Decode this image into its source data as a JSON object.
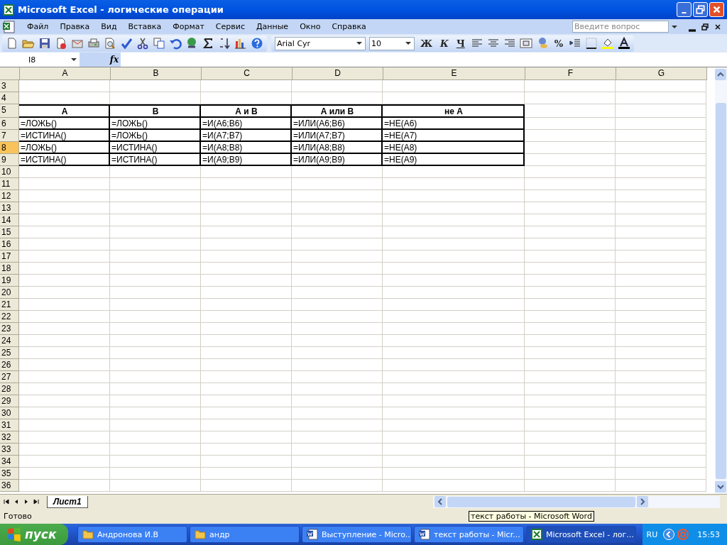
{
  "window": {
    "title": "Microsoft Excel - логические операции"
  },
  "menu": [
    "Файл",
    "Правка",
    "Вид",
    "Вставка",
    "Формат",
    "Сервис",
    "Данные",
    "Окно",
    "Справка"
  ],
  "help_search": {
    "placeholder": "Введите вопрос"
  },
  "format_toolbar": {
    "font": "Arial Cyr",
    "size": "10",
    "bold": "Ж",
    "italic": "К",
    "underline": "Ч",
    "percent": "%"
  },
  "formula_bar": {
    "name_box": "I8",
    "fx": "fx"
  },
  "columns": [
    {
      "label": "A",
      "selected": false
    },
    {
      "label": "B",
      "selected": false
    },
    {
      "label": "C",
      "selected": false
    },
    {
      "label": "D",
      "selected": false
    },
    {
      "label": "E",
      "selected": false
    },
    {
      "label": "F",
      "selected": false
    },
    {
      "label": "G",
      "selected": false
    }
  ],
  "rows": [
    {
      "number": "3",
      "selected": false,
      "kind": "empty"
    },
    {
      "number": "4",
      "selected": false,
      "kind": "empty"
    },
    {
      "number": "5",
      "selected": false,
      "kind": "header",
      "cells": [
        "A",
        "B",
        "А и В",
        "А или В",
        "не А"
      ]
    },
    {
      "number": "6",
      "selected": false,
      "kind": "data",
      "cells": [
        "=ЛОЖЬ()",
        "=ЛОЖЬ()",
        "=И(A6;B6)",
        "=ИЛИ(A6;B6)",
        "=НЕ(A6)"
      ]
    },
    {
      "number": "7",
      "selected": false,
      "kind": "data",
      "cells": [
        "=ИСТИНА()",
        "=ЛОЖЬ()",
        "=И(A7;B7)",
        "=ИЛИ(A7;B7)",
        "=НЕ(A7)"
      ]
    },
    {
      "number": "8",
      "selected": true,
      "kind": "data",
      "cells": [
        "=ЛОЖЬ()",
        "=ИСТИНА()",
        "=И(A8;B8)",
        "=ИЛИ(A8;B8)",
        "=НЕ(A8)"
      ]
    },
    {
      "number": "9",
      "selected": false,
      "kind": "data",
      "cells": [
        "=ИСТИНА()",
        "=ИСТИНА()",
        "=И(A9;B9)",
        "=ИЛИ(A9;B9)",
        "=НЕ(A9)"
      ]
    },
    {
      "number": "10",
      "selected": false,
      "kind": "empty"
    },
    {
      "number": "11",
      "selected": false,
      "kind": "empty"
    },
    {
      "number": "12",
      "selected": false,
      "kind": "empty"
    },
    {
      "number": "13",
      "selected": false,
      "kind": "empty"
    },
    {
      "number": "14",
      "selected": false,
      "kind": "empty"
    },
    {
      "number": "15",
      "selected": false,
      "kind": "empty"
    },
    {
      "number": "16",
      "selected": false,
      "kind": "empty"
    },
    {
      "number": "17",
      "selected": false,
      "kind": "empty"
    },
    {
      "number": "18",
      "selected": false,
      "kind": "empty"
    },
    {
      "number": "19",
      "selected": false,
      "kind": "empty"
    },
    {
      "number": "20",
      "selected": false,
      "kind": "empty"
    },
    {
      "number": "21",
      "selected": false,
      "kind": "empty"
    },
    {
      "number": "22",
      "selected": false,
      "kind": "empty"
    },
    {
      "number": "23",
      "selected": false,
      "kind": "empty"
    },
    {
      "number": "24",
      "selected": false,
      "kind": "empty"
    },
    {
      "number": "25",
      "selected": false,
      "kind": "empty"
    },
    {
      "number": "26",
      "selected": false,
      "kind": "empty"
    },
    {
      "number": "27",
      "selected": false,
      "kind": "empty"
    },
    {
      "number": "28",
      "selected": false,
      "kind": "empty"
    },
    {
      "number": "29",
      "selected": false,
      "kind": "empty"
    },
    {
      "number": "30",
      "selected": false,
      "kind": "empty"
    },
    {
      "number": "31",
      "selected": false,
      "kind": "empty"
    },
    {
      "number": "32",
      "selected": false,
      "kind": "empty"
    },
    {
      "number": "33",
      "selected": false,
      "kind": "empty"
    },
    {
      "number": "34",
      "selected": false,
      "kind": "empty"
    },
    {
      "number": "35",
      "selected": false,
      "kind": "empty"
    },
    {
      "number": "36",
      "selected": false,
      "kind": "empty"
    }
  ],
  "sheet_tabs": [
    {
      "label": "Лист1",
      "selected": true
    }
  ],
  "status_bar": {
    "text": "Готово"
  },
  "tooltip": "текст работы - Microsoft Word",
  "taskbar": {
    "start": "пуск",
    "items": [
      {
        "label": "Андронова И.В",
        "kind": "folder",
        "selected": false
      },
      {
        "label": "андр",
        "kind": "folder",
        "selected": false
      },
      {
        "label": "Выступление - Micro...",
        "kind": "word",
        "selected": false
      },
      {
        "label": "текст работы - Micr...",
        "kind": "word",
        "selected": false
      },
      {
        "label": "Microsoft Excel - лог...",
        "kind": "excel",
        "selected": true
      }
    ],
    "language": "RU",
    "clock": "15:53"
  }
}
